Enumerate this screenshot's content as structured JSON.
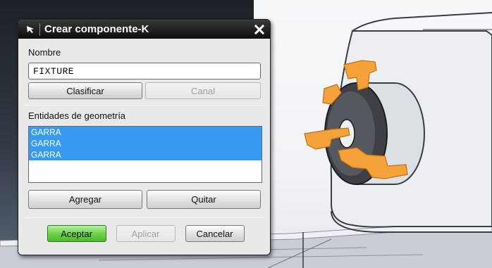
{
  "dialog": {
    "title": "Crear componente-K",
    "name_label": "Nombre",
    "name_value": "FIXTURE",
    "classify_label": "Clasificar",
    "channel_label": "Canal",
    "geometry_label": "Entidades de geometría",
    "geometry_items": [
      "GARRA",
      "GARRA",
      "GARRA"
    ],
    "add_label": "Agregar",
    "remove_label": "Quitar",
    "ok_label": "Aceptar",
    "apply_label": "Aplicar",
    "cancel_label": "Cancelar"
  },
  "colors": {
    "selection": "#3899f0",
    "jaw_highlight": "#f5a23a",
    "ok_button": "#6fd34c",
    "title_bar": "#111111"
  },
  "icons": {
    "title": "arrow-cursor-icon",
    "close": "close-icon"
  }
}
